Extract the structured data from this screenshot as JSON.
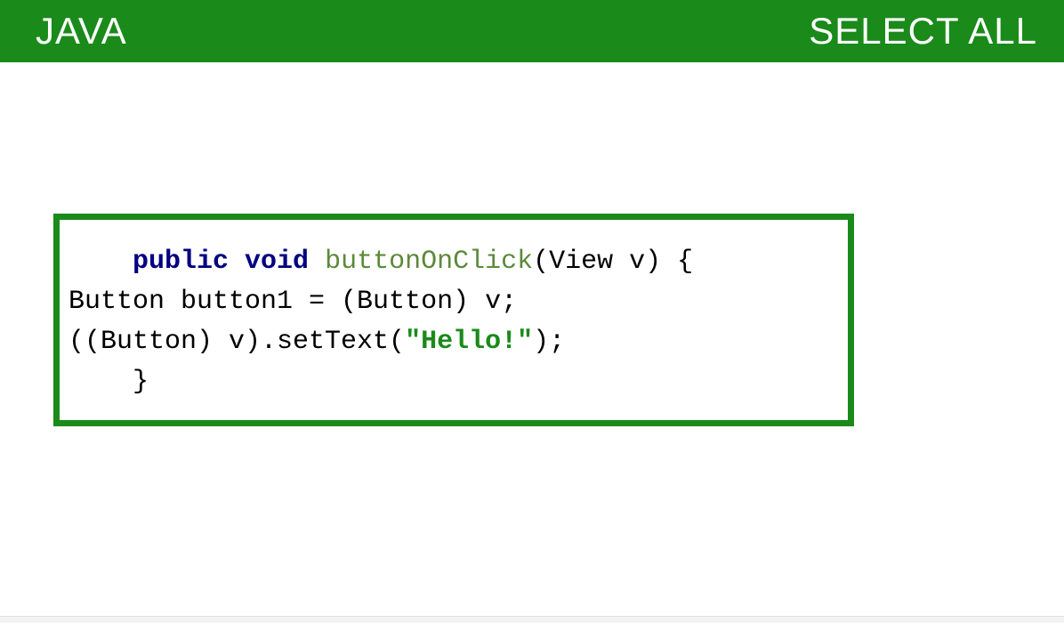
{
  "header": {
    "title": "JAVA",
    "select_all": "SELECT ALL"
  },
  "code": {
    "line1_indent": "    ",
    "line1_kw": "public void ",
    "line1_fn": "buttonOnClick",
    "line1_rest": "(View v) {",
    "line2": "Button button1 = (Button) v;",
    "line3_pre": "((Button) v).setText(",
    "line3_str": "\"Hello!\"",
    "line3_post": ");",
    "line4": "    }"
  }
}
